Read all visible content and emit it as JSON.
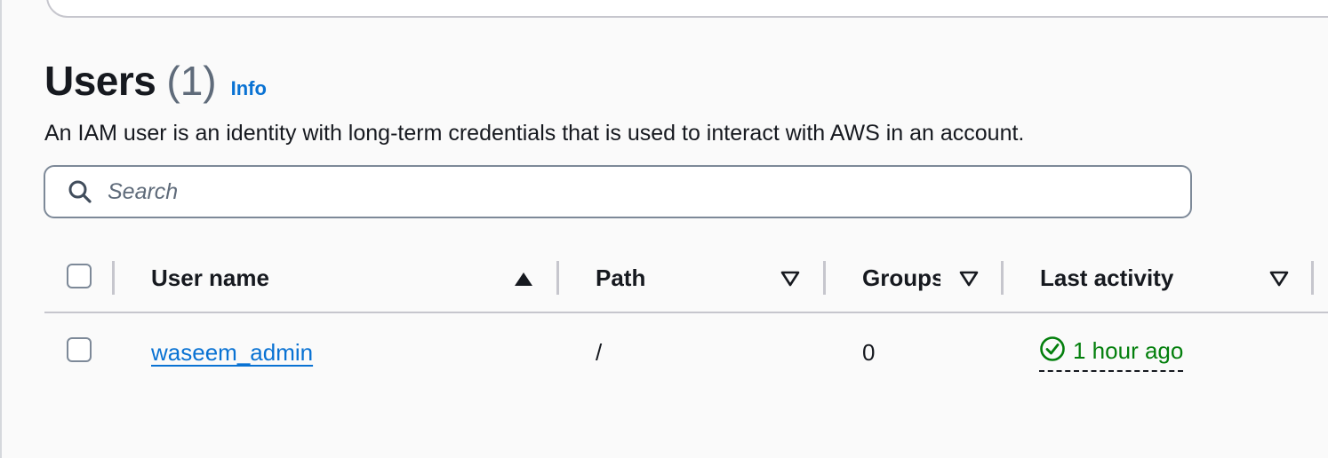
{
  "header": {
    "title": "Users",
    "count": "(1)",
    "info_label": "Info"
  },
  "description": "An IAM user is an identity with long-term credentials that is used to interact with AWS in an account.",
  "search": {
    "placeholder": "Search",
    "value": ""
  },
  "table": {
    "columns": [
      {
        "label": "User name",
        "sort": "ascending"
      },
      {
        "label": "Path",
        "sort": "none"
      },
      {
        "label": "Groups",
        "sort": "none"
      },
      {
        "label": "Last activity",
        "sort": "none"
      }
    ],
    "rows": [
      {
        "user_name": "waseem_admin",
        "path": "/",
        "groups": "0",
        "last_activity": "1 hour ago",
        "status_icon": "check-circle-icon"
      }
    ]
  },
  "colors": {
    "link": "#0972d3",
    "success": "#037f0c",
    "border": "#7d8998",
    "text": "#16191f"
  }
}
